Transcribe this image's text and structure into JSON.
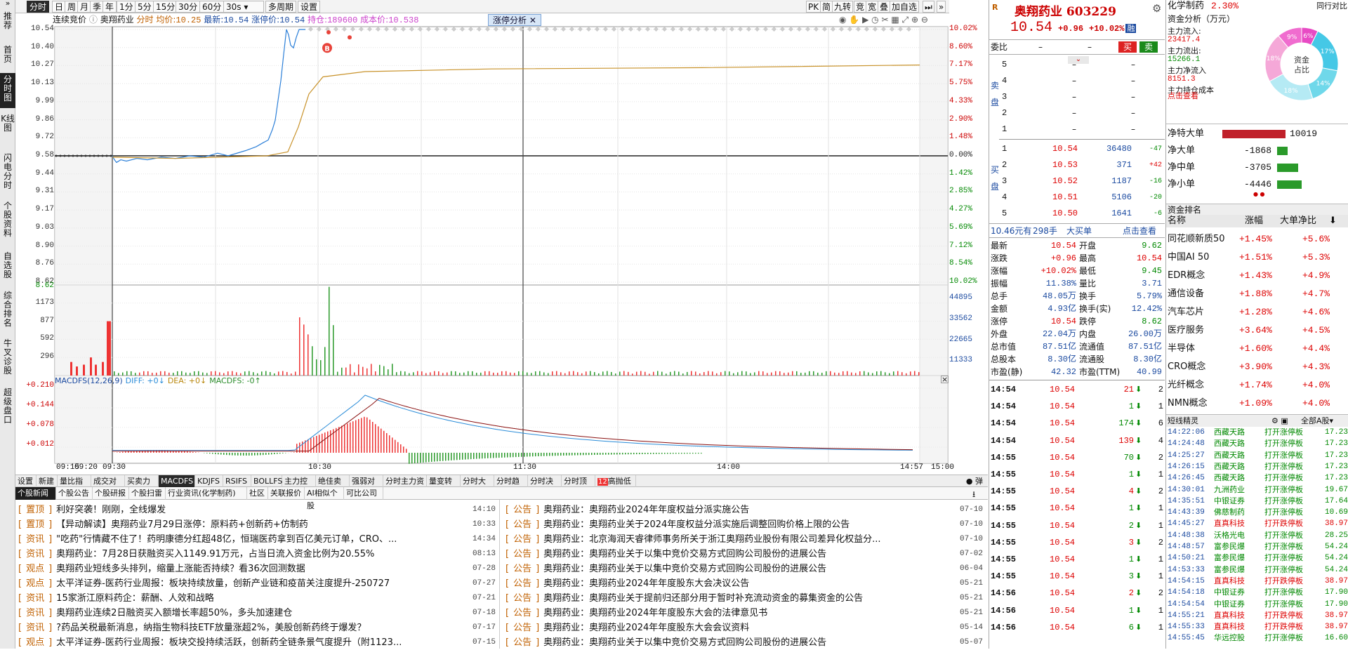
{
  "left_nav": [
    "推荐",
    "首页",
    "分时图",
    "K线图",
    "闪电分时",
    "个股资料",
    "自选股",
    "综合排名",
    "牛叉诊股",
    "超级盘口"
  ],
  "left_nav_top": "»",
  "toolbar": {
    "periods": [
      "分时",
      "日",
      "周",
      "月",
      "季",
      "年",
      "1分",
      "5分",
      "15分",
      "30分",
      "60分"
    ],
    "sel_period": "30s",
    "multi": "多周期",
    "settings": "设置",
    "right": [
      "PK",
      "简",
      "九转",
      "竞",
      "宽",
      "叠",
      "加自选"
    ]
  },
  "chart": {
    "info": {
      "mode": "连续竞价",
      "name": "奥翔药业",
      "label_fs": "分时",
      "avg_label": "均价:",
      "avg": "10.25",
      "last_label": "最新:",
      "last": "10.54",
      "zt_label": "涨停价:",
      "zt": "10.54",
      "hold_label": "持仓:",
      "hold": "189600",
      "cost_label": "成本价:",
      "cost": "10.538"
    },
    "zt_tag": "涨停分析",
    "y_left": [
      "10.54",
      "10.40",
      "10.27",
      "10.13",
      "9.99",
      "9.86",
      "9.72",
      "9.58",
      "9.44",
      "9.31",
      "9.17",
      "9.03",
      "8.90",
      "8.76",
      "8.62"
    ],
    "y_right": [
      "10.02%",
      "8.60%",
      "7.17%",
      "5.75%",
      "4.33%",
      "2.90%",
      "1.48%",
      "0.00%",
      "1.42%",
      "2.85%",
      "4.27%",
      "5.69%",
      "7.12%",
      "8.54%",
      "10.02%"
    ],
    "vol_left": [
      "8.62",
      "1173",
      "877",
      "592",
      "296"
    ],
    "vol_right": [
      "44895",
      "33562",
      "22665",
      "11333"
    ],
    "macd_label": "MACDFS(12,26,9)",
    "macd_diff": "DIFF: +0↓",
    "macd_dea": "DEA: +0↓",
    "macd_val": "MACDFS: -0↑",
    "macd_left": [
      "+0.210",
      "+0.144",
      "+0.078",
      "+0.012"
    ],
    "x_labels": [
      "09:15",
      "09:20",
      "09:30",
      "10:30",
      "11:30",
      "14:00",
      "14:57",
      "15:00"
    ],
    "buy_marker": "B",
    "price_series": {
      "times": [
        "09:30",
        "09:40",
        "09:50",
        "10:00",
        "10:10",
        "10:15",
        "10:18",
        "10:20",
        "10:22",
        "10:25",
        "10:27",
        "10:30",
        "10:35",
        "14:57"
      ],
      "prices": [
        9.58,
        9.54,
        9.55,
        9.56,
        9.58,
        9.62,
        9.75,
        10.1,
        10.54,
        10.54,
        10.45,
        10.54,
        10.54,
        10.54
      ]
    }
  },
  "bottom_tabs": [
    "设置",
    "新建",
    "量比指标",
    "成交对比",
    "买卖力道",
    "MACDFS",
    "KDJFS",
    "RSIFS",
    "BOLLFS",
    "主力控盘",
    "绝佳卖点",
    "强弱对比",
    "分时主力资金",
    "量变转势",
    "分时大单",
    "分时趋势",
    "分时决策",
    "分时顶底",
    "高抛低吸"
  ],
  "bottom_tab_badge": "12",
  "bottom_toggle": "弹",
  "news_tabs": [
    "个股新闻",
    "个股公告",
    "个股研报",
    "个股扫雷",
    "行业资讯(化学制药)",
    "社区",
    "关联报价",
    "AI相似个股",
    "可比公司"
  ],
  "news_left": [
    {
      "cat": "置顶",
      "title": "利好突袭！刚刚，全线爆发",
      "date": "14:10"
    },
    {
      "cat": "置顶",
      "title": "【异动解读】奥翔药业7月29日涨停：原料药+创新药+仿制药",
      "date": "10:33"
    },
    {
      "cat": "资讯",
      "title": "\"吃药\"行情藏不住了！药明康德分红超48亿，恒瑞医药拿到百亿美元订单，CRO、...",
      "date": "14:34"
    },
    {
      "cat": "资讯",
      "title": "奥翔药业：7月28日获融资买入1149.91万元，占当日流入资金比例为20.55%",
      "date": "08:13"
    },
    {
      "cat": "观点",
      "title": "奥翔药业短线多头排列，缩量上涨能否持续？看36次回测数据",
      "date": "07-28"
    },
    {
      "cat": "观点",
      "title": "太平洋证券-医药行业周报：板块持续放量，创新产业链和疫苗关注度提升-250727",
      "date": "07-27"
    },
    {
      "cat": "资讯",
      "title": "15家浙江原料药企：薪酬、人效和战略",
      "date": "07-21"
    },
    {
      "cat": "资讯",
      "title": "奥翔药业连续2日融资买入额增长率超50%，多头加速建仓",
      "date": "07-18"
    },
    {
      "cat": "资讯",
      "title": "?药品关税最新消息，纳指生物科技ETF放量涨超2%，美股创新药终于爆发？",
      "date": "07-17"
    },
    {
      "cat": "观点",
      "title": "太平洋证券-医药行业周报：板块交投持续活跃，创新药全链条景气度提升（附1123...",
      "date": "07-15"
    }
  ],
  "news_right": [
    {
      "cat": "公告",
      "title": "奥翔药业：奥翔药业2024年年度权益分派实施公告",
      "date": "07-10"
    },
    {
      "cat": "公告",
      "title": "奥翔药业：奥翔药业关于2024年度权益分派实施后调整回购价格上限的公告",
      "date": "07-10"
    },
    {
      "cat": "公告",
      "title": "奥翔药业：北京海润天睿律师事务所关于浙江奥翔药业股份有限公司差异化权益分...",
      "date": "07-10"
    },
    {
      "cat": "公告",
      "title": "奥翔药业：奥翔药业关于以集中竞价交易方式回购公司股份的进展公告",
      "date": "07-02"
    },
    {
      "cat": "公告",
      "title": "奥翔药业：奥翔药业关于以集中竞价交易方式回购公司股份的进展公告",
      "date": "06-04"
    },
    {
      "cat": "公告",
      "title": "奥翔药业：奥翔药业2024年年度股东大会决议公告",
      "date": "05-21"
    },
    {
      "cat": "公告",
      "title": "奥翔药业：奥翔药业关于提前归还部分用于暂时补充流动资金的募集资金的公告",
      "date": "05-21"
    },
    {
      "cat": "公告",
      "title": "奥翔药业：奥翔药业2024年年度股东大会的法律意见书",
      "date": "05-21"
    },
    {
      "cat": "公告",
      "title": "奥翔药业：奥翔药业2024年年度股东大会会议资料",
      "date": "05-14"
    },
    {
      "cat": "公告",
      "title": "奥翔药业：奥翔药业关于以集中竞价交易方式回购公司股份的进展公告",
      "date": "05-07"
    }
  ],
  "quote": {
    "name": "奥翔药业",
    "code": "603229",
    "price": "10.54",
    "change": "+0.96",
    "pct": "+10.02%",
    "market": "融",
    "webi_label": "委比",
    "webi_v": [
      "–",
      "–"
    ],
    "sell_btn_buy": "买",
    "sell_btn_sell": "卖",
    "sell_label": "卖盘",
    "buy_label": "买盘",
    "asks": [
      {
        "lv": "5",
        "p": "–",
        "v": "–"
      },
      {
        "lv": "4",
        "p": "–",
        "v": "–"
      },
      {
        "lv": "3",
        "p": "–",
        "v": "–"
      },
      {
        "lv": "2",
        "p": "–",
        "v": "–"
      },
      {
        "lv": "1",
        "p": "–",
        "v": "–"
      }
    ],
    "bids": [
      {
        "lv": "1",
        "p": "10.54",
        "v": "36480",
        "d": "-47"
      },
      {
        "lv": "2",
        "p": "10.53",
        "v": "371",
        "d": "+42"
      },
      {
        "lv": "3",
        "p": "10.52",
        "v": "1187",
        "d": "-16"
      },
      {
        "lv": "4",
        "p": "10.51",
        "v": "5106",
        "d": "-20"
      },
      {
        "lv": "5",
        "p": "10.50",
        "v": "1641",
        "d": "-6"
      }
    ],
    "big_order": {
      "amt": "10.46元有",
      "hands": "298手",
      "label": "大买单",
      "link": "点击查看"
    },
    "stats": [
      {
        "k1": "最新",
        "v1": "10.54",
        "k2": "开盘",
        "v2": "9.62"
      },
      {
        "k1": "涨跌",
        "v1": "+0.96",
        "k2": "最高",
        "v2": "10.54"
      },
      {
        "k1": "涨幅",
        "v1": "+10.02%",
        "k2": "最低",
        "v2": "9.45"
      },
      {
        "k1": "振幅",
        "v1": "11.38%",
        "k2": "量比",
        "v2": "3.71"
      },
      {
        "k1": "总手",
        "v1": "48.05万",
        "k2": "换手",
        "v2": "5.79%"
      },
      {
        "k1": "金额",
        "v1": "4.93亿",
        "k2": "换手(实)",
        "v2": "12.42%"
      },
      {
        "k1": "涨停",
        "v1": "10.54",
        "k2": "跌停",
        "v2": "8.62"
      },
      {
        "k1": "外盘",
        "v1": "22.04万",
        "k2": "内盘",
        "v2": "26.00万"
      },
      {
        "k1": "总市值",
        "v1": "87.51亿",
        "k2": "流通值",
        "v2": "87.51亿"
      },
      {
        "k1": "总股本",
        "v1": "8.30亿",
        "k2": "流通股",
        "v2": "8.30亿"
      },
      {
        "k1": "市盈(静)",
        "v1": "42.32",
        "k2": "市盈(TTM)",
        "v2": "40.99"
      }
    ],
    "ticks": [
      {
        "t": "14:54",
        "p": "10.54",
        "v": "21",
        "n": "2"
      },
      {
        "t": "14:54",
        "p": "10.54",
        "v": "1",
        "n": "1"
      },
      {
        "t": "14:54",
        "p": "10.54",
        "v": "174",
        "n": "6"
      },
      {
        "t": "14:54",
        "p": "10.54",
        "v": "139",
        "n": "4"
      },
      {
        "t": "14:55",
        "p": "10.54",
        "v": "70",
        "n": "2"
      },
      {
        "t": "14:55",
        "p": "10.54",
        "v": "1",
        "n": "1"
      },
      {
        "t": "14:55",
        "p": "10.54",
        "v": "4",
        "n": "2"
      },
      {
        "t": "14:55",
        "p": "10.54",
        "v": "1",
        "n": "1"
      },
      {
        "t": "14:55",
        "p": "10.54",
        "v": "2",
        "n": "1"
      },
      {
        "t": "14:55",
        "p": "10.54",
        "v": "3",
        "n": "2"
      },
      {
        "t": "14:55",
        "p": "10.54",
        "v": "1",
        "n": "1"
      },
      {
        "t": "14:55",
        "p": "10.54",
        "v": "3",
        "n": "1"
      },
      {
        "t": "14:56",
        "p": "10.54",
        "v": "2",
        "n": "2"
      },
      {
        "t": "14:56",
        "p": "10.54",
        "v": "1",
        "n": "1"
      },
      {
        "t": "14:56",
        "p": "10.54",
        "v": "6",
        "n": "1"
      }
    ]
  },
  "right": {
    "sector": "化学制药",
    "sector_pct": "2.30%",
    "compare": "同行对比",
    "fund_title": "资金分析（万元）",
    "fund": [
      {
        "k": "主力流入:",
        "v": "23417.4"
      },
      {
        "k": "主力流出:",
        "v": "15266.1"
      },
      {
        "k": "主力净流入",
        "v": "8151.3"
      },
      {
        "k": "主力持仓成本",
        "v": ""
      }
    ],
    "fund_link": "点击查看",
    "donut_center": "资金占比",
    "donut_labels": [
      "6%",
      "17%",
      "14%",
      "18%",
      "18%",
      "9%"
    ],
    "donut_colors": [
      "#e84bc4",
      "#45c8e6",
      "#6fd8ea",
      "#b5eaf4",
      "#f5a8d8",
      "#f06ccf"
    ],
    "net": [
      {
        "k": "净特大单",
        "v": "10019",
        "dir": "up",
        "mag": 1.0
      },
      {
        "k": "净大单",
        "v": "-1868",
        "dir": "down",
        "mag": 0.19
      },
      {
        "k": "净中单",
        "v": "-3705",
        "dir": "down",
        "mag": 0.37
      },
      {
        "k": "净小单",
        "v": "-4446",
        "dir": "down",
        "mag": 0.44
      }
    ],
    "rank_title": "资金排名",
    "rank_head": [
      "名称",
      "涨幅",
      "大单净比"
    ],
    "rank": [
      {
        "n": "同花顺新质50",
        "p": "+1.45%",
        "r": "+5.6%"
      },
      {
        "n": "中国AI 50",
        "p": "+1.51%",
        "r": "+5.3%"
      },
      {
        "n": "EDR概念",
        "p": "+1.43%",
        "r": "+4.9%"
      },
      {
        "n": "通信设备",
        "p": "+1.88%",
        "r": "+4.7%"
      },
      {
        "n": "汽车芯片",
        "p": "+1.28%",
        "r": "+4.6%"
      },
      {
        "n": "医疗服务",
        "p": "+3.64%",
        "r": "+4.5%"
      },
      {
        "n": "半导体",
        "p": "+1.60%",
        "r": "+4.4%"
      },
      {
        "n": "CRO概念",
        "p": "+3.90%",
        "r": "+4.3%"
      },
      {
        "n": "光纤概念",
        "p": "+1.74%",
        "r": "+4.0%"
      },
      {
        "n": "NMN概念",
        "p": "+1.09%",
        "r": "+4.0%"
      }
    ],
    "ds_title": "短线精灵",
    "ds_filter": "全部A股",
    "ds": [
      {
        "t": "14:22:06",
        "n": "西藏天路",
        "e": "打开涨停板",
        "v": "17.23"
      },
      {
        "t": "14:24:48",
        "n": "西藏天路",
        "e": "打开涨停板",
        "v": "17.23"
      },
      {
        "t": "14:25:27",
        "n": "西藏天路",
        "e": "打开涨停板",
        "v": "17.23"
      },
      {
        "t": "14:26:15",
        "n": "西藏天路",
        "e": "打开涨停板",
        "v": "17.23"
      },
      {
        "t": "14:26:45",
        "n": "西藏天路",
        "e": "打开涨停板",
        "v": "17.23"
      },
      {
        "t": "14:30:01",
        "n": "九洲药业",
        "e": "打开涨停板",
        "v": "19.67"
      },
      {
        "t": "14:35:51",
        "n": "中银证券",
        "e": "打开涨停板",
        "v": "17.64"
      },
      {
        "t": "14:43:39",
        "n": "佛慈制药",
        "e": "打开涨停板",
        "v": "10.69"
      },
      {
        "t": "14:45:27",
        "n": "直真科技",
        "e": "打开跌停板",
        "v": "38.97"
      },
      {
        "t": "14:48:38",
        "n": "沃格光电",
        "e": "打开涨停板",
        "v": "28.25"
      },
      {
        "t": "14:48:57",
        "n": "富参民爆",
        "e": "打开涨停板",
        "v": "54.24"
      },
      {
        "t": "14:50:21",
        "n": "富参民爆",
        "e": "打开涨停板",
        "v": "54.24"
      },
      {
        "t": "14:53:33",
        "n": "富参民爆",
        "e": "打开涨停板",
        "v": "54.24"
      },
      {
        "t": "14:54:15",
        "n": "直真科技",
        "e": "打开跌停板",
        "v": "38.97"
      },
      {
        "t": "14:54:18",
        "n": "中银证券",
        "e": "打开涨停板",
        "v": "17.90"
      },
      {
        "t": "14:54:54",
        "n": "中银证券",
        "e": "打开涨停板",
        "v": "17.90"
      },
      {
        "t": "14:55:21",
        "n": "直真科技",
        "e": "打开跌停板",
        "v": "38.97"
      },
      {
        "t": "14:55:33",
        "n": "直真科技",
        "e": "打开跌停板",
        "v": "38.97"
      },
      {
        "t": "14:55:45",
        "n": "华远控股",
        "e": "打开涨停板",
        "v": "16.60"
      }
    ]
  }
}
